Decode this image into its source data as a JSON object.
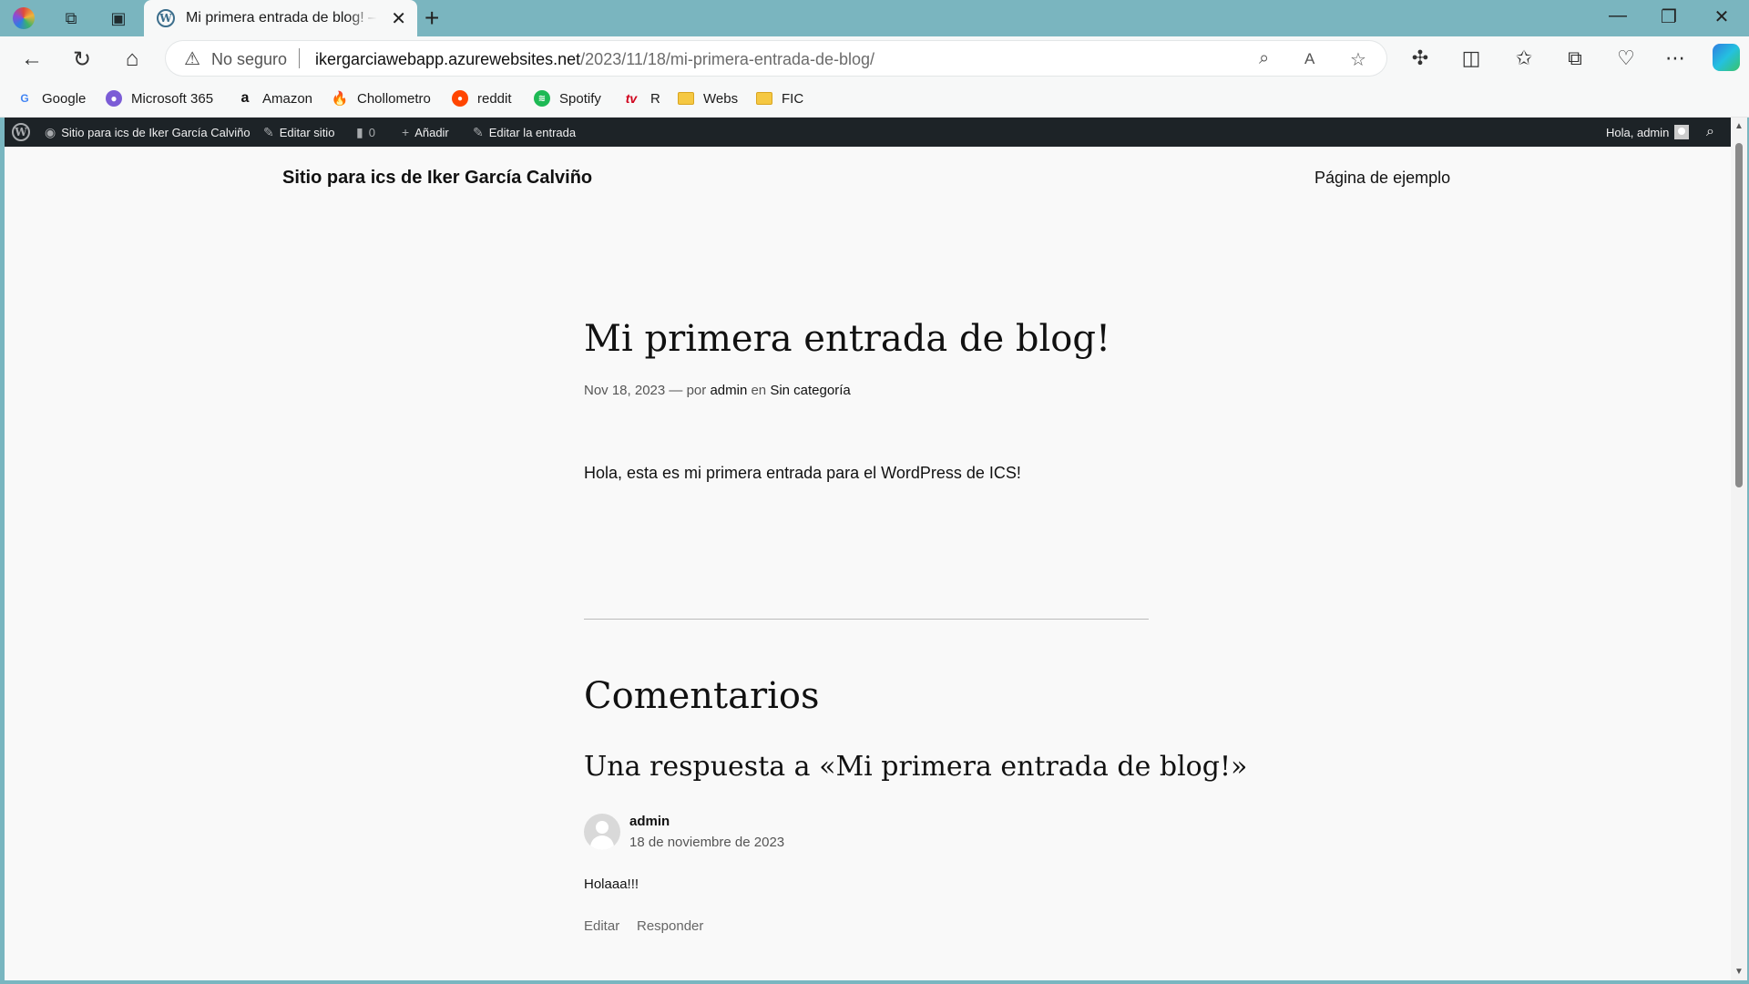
{
  "browser": {
    "tab_title": "Mi primera entrada de blog! – Sitio para ics de Iker García Calviño",
    "security_label": "No seguro",
    "url_host": "ikergarciawebapp.azurewebsites.net",
    "url_path": "/2023/11/18/mi-primera-entrada-de-blog/",
    "bookmarks": [
      {
        "label": "Google",
        "icon": "google-icon",
        "color": "#4285f4"
      },
      {
        "label": "Microsoft 365",
        "icon": "microsoft365-icon",
        "color": "#7b5cd6"
      },
      {
        "label": "Amazon",
        "icon": "amazon-icon",
        "color": "#111111"
      },
      {
        "label": "Chollometro",
        "icon": "flame-icon",
        "color": "#e8591a"
      },
      {
        "label": "reddit",
        "icon": "reddit-icon",
        "color": "#ff4500"
      },
      {
        "label": "Spotify",
        "icon": "spotify-icon",
        "color": "#1db954"
      },
      {
        "label": "R",
        "icon": "tv-icon",
        "color": "#d0021b"
      },
      {
        "label": "Webs",
        "icon": "folder-icon",
        "color": "#f5c842"
      },
      {
        "label": "FIC",
        "icon": "folder-icon",
        "color": "#f5c842"
      }
    ]
  },
  "adminbar": {
    "site_name": "Sitio para ics de Iker García Calviño",
    "edit_site": "Editar sitio",
    "comments_count": "0",
    "add_new": "Añadir",
    "edit_post": "Editar la entrada",
    "greeting": "Hola, admin"
  },
  "site": {
    "title": "Sitio para ics de Iker García Calviño",
    "nav_link": "Página de ejemplo"
  },
  "post": {
    "title": "Mi primera entrada de blog!",
    "date": "Nov 18, 2023",
    "by_prefix": "— por",
    "author": "admin",
    "in_word": "en",
    "category": "Sin categoría",
    "content": "Hola, esta es mi primera entrada para el WordPress de ICS!"
  },
  "comments": {
    "heading": "Comentarios",
    "reply_heading": "Una respuesta a «Mi primera entrada de blog!»",
    "items": [
      {
        "author": "admin",
        "date": "18 de noviembre de 2023",
        "text": "Holaaa!!!",
        "edit": "Editar",
        "reply": "Responder"
      }
    ]
  },
  "colors": {
    "tabstrip": "#7ab5bf",
    "adminbar": "#1d2327",
    "page_bg": "#f9f9f9"
  }
}
